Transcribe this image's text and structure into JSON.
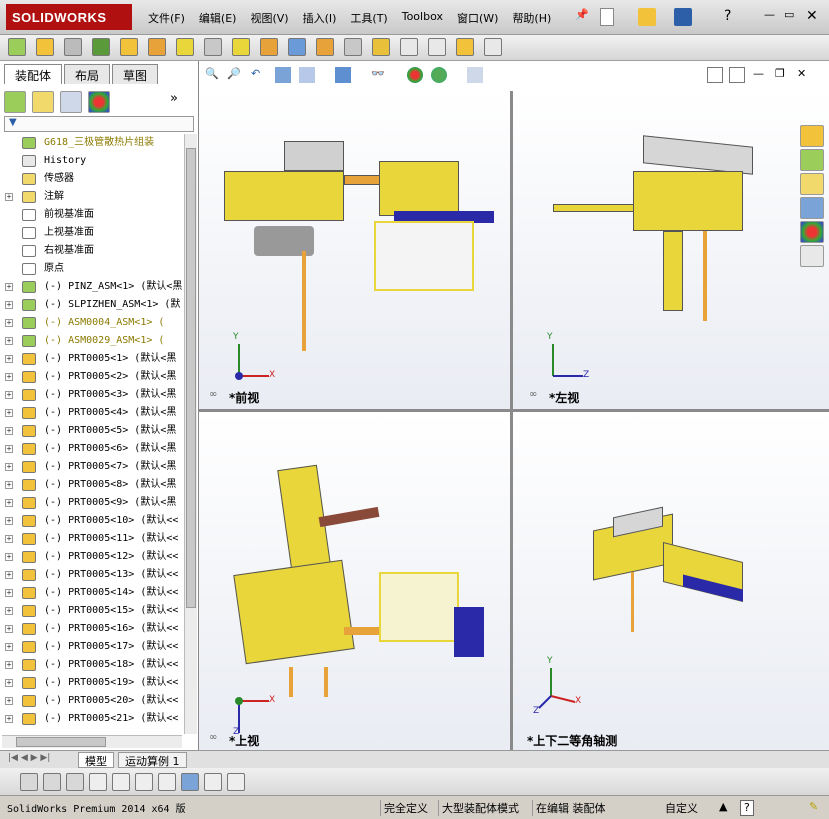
{
  "app": {
    "logo": "SOLIDWORKS"
  },
  "menu": [
    "文件(F)",
    "编辑(E)",
    "视图(V)",
    "插入(I)",
    "工具(T)",
    "Toolbox",
    "窗口(W)",
    "帮助(H)"
  ],
  "panel": {
    "tabs": [
      "装配体",
      "布局",
      "草图"
    ],
    "tree": [
      {
        "label": "G618_三极管散热片组装",
        "icon": "assembly-warning-icon",
        "warn": true,
        "expand": ""
      },
      {
        "label": "History",
        "icon": "history-icon",
        "expand": ""
      },
      {
        "label": "传感器",
        "icon": "sensor-icon",
        "expand": ""
      },
      {
        "label": "注解",
        "icon": "annotation-icon",
        "expand": "+"
      },
      {
        "label": "前视基准面",
        "icon": "plane-icon",
        "expand": ""
      },
      {
        "label": "上视基准面",
        "icon": "plane-icon",
        "expand": ""
      },
      {
        "label": "右视基准面",
        "icon": "plane-icon",
        "expand": ""
      },
      {
        "label": "原点",
        "icon": "origin-icon",
        "expand": ""
      },
      {
        "label": "(-) PINZ_ASM<1> (默认<黑",
        "icon": "subassembly-icon",
        "expand": "+"
      },
      {
        "label": "(-) SLPIZHEN_ASM<1> (默",
        "icon": "subassembly-icon",
        "expand": "+"
      },
      {
        "label": "(-) ASM0004_ASM<1> (",
        "icon": "subassembly-warning-icon",
        "warn": true,
        "expand": "+"
      },
      {
        "label": "(-) ASM0029_ASM<1> (",
        "icon": "subassembly-warning-icon",
        "warn": true,
        "expand": "+"
      },
      {
        "label": "(-) PRT0005<1> (默认<黑",
        "icon": "part-icon",
        "expand": "+"
      },
      {
        "label": "(-) PRT0005<2> (默认<黑",
        "icon": "part-icon",
        "expand": "+"
      },
      {
        "label": "(-) PRT0005<3> (默认<黑",
        "icon": "part-icon",
        "expand": "+"
      },
      {
        "label": "(-) PRT0005<4> (默认<黑",
        "icon": "part-icon",
        "expand": "+"
      },
      {
        "label": "(-) PRT0005<5> (默认<黑",
        "icon": "part-icon",
        "expand": "+"
      },
      {
        "label": "(-) PRT0005<6> (默认<黑",
        "icon": "part-icon",
        "expand": "+"
      },
      {
        "label": "(-) PRT0005<7> (默认<黑",
        "icon": "part-icon",
        "expand": "+"
      },
      {
        "label": "(-) PRT0005<8> (默认<黑",
        "icon": "part-icon",
        "expand": "+"
      },
      {
        "label": "(-) PRT0005<9> (默认<黑",
        "icon": "part-icon",
        "expand": "+"
      },
      {
        "label": "(-) PRT0005<10> (默认<<",
        "icon": "part-icon",
        "expand": "+"
      },
      {
        "label": "(-) PRT0005<11> (默认<<",
        "icon": "part-icon",
        "expand": "+"
      },
      {
        "label": "(-) PRT0005<12> (默认<<",
        "icon": "part-icon",
        "expand": "+"
      },
      {
        "label": "(-) PRT0005<13> (默认<<",
        "icon": "part-icon",
        "expand": "+"
      },
      {
        "label": "(-) PRT0005<14> (默认<<",
        "icon": "part-icon",
        "expand": "+"
      },
      {
        "label": "(-) PRT0005<15> (默认<<",
        "icon": "part-icon",
        "expand": "+"
      },
      {
        "label": "(-) PRT0005<16> (默认<<",
        "icon": "part-icon",
        "expand": "+"
      },
      {
        "label": "(-) PRT0005<17> (默认<<",
        "icon": "part-icon",
        "expand": "+"
      },
      {
        "label": "(-) PRT0005<18> (默认<<",
        "icon": "part-icon",
        "expand": "+"
      },
      {
        "label": "(-) PRT0005<19> (默认<<",
        "icon": "part-icon",
        "expand": "+"
      },
      {
        "label": "(-) PRT0005<20> (默认<<",
        "icon": "part-icon",
        "expand": "+"
      },
      {
        "label": "(-) PRT0005<21> (默认<<",
        "icon": "part-icon",
        "expand": "+"
      }
    ]
  },
  "views": {
    "front": "*前视",
    "left": "*左视",
    "top": "*上视",
    "iso": "*上下二等角轴测"
  },
  "axes": {
    "x": "X",
    "y": "Y",
    "z": "Z"
  },
  "bottom_tabs": [
    "模型",
    "运动算例 1"
  ],
  "status": {
    "product": "SolidWorks Premium 2014 x64 版",
    "defined": "完全定义",
    "mode": "大型装配体模式",
    "editing": "在编辑 装配体",
    "custom": "自定义",
    "help": "?"
  },
  "colors": {
    "part_yellow": "#e8d63a",
    "part_blue": "#2a2aa8",
    "accent_red": "#b01010"
  }
}
